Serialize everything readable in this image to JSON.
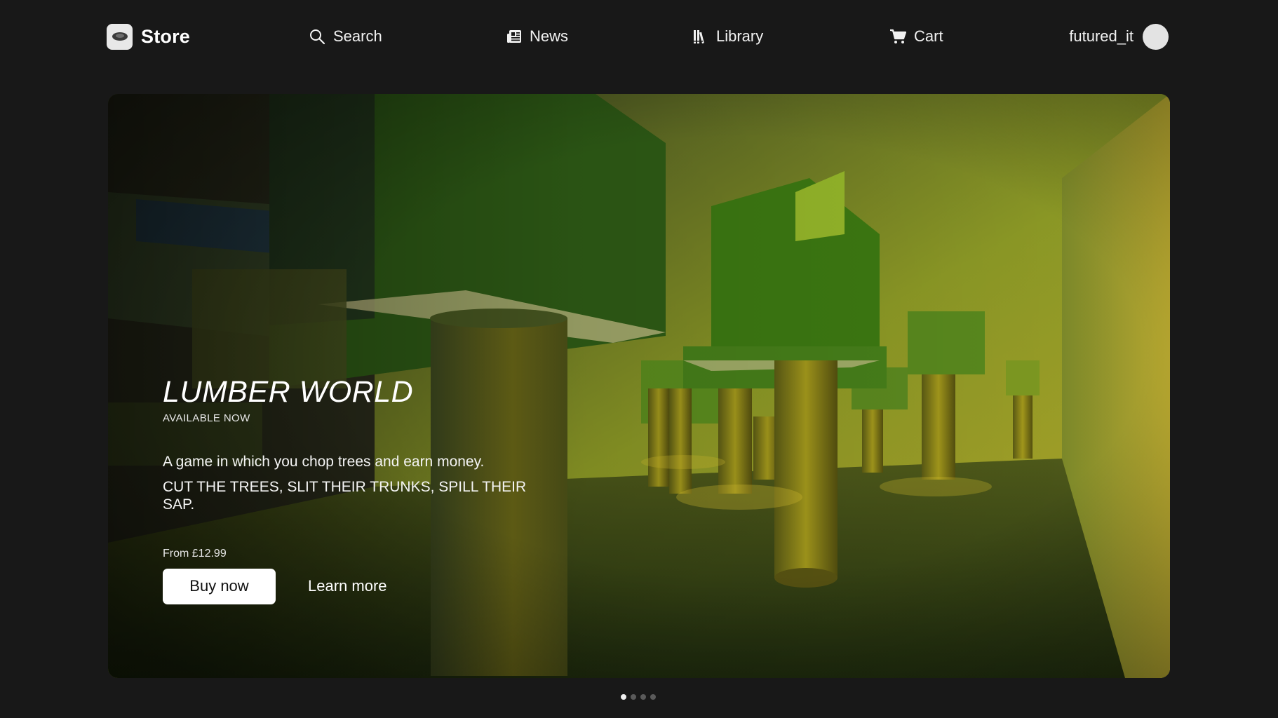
{
  "header": {
    "brand_label": "Store",
    "nav": [
      {
        "label": "Search",
        "icon": "search-icon"
      },
      {
        "label": "News",
        "icon": "newspaper-icon"
      },
      {
        "label": "Library",
        "icon": "library-icon"
      },
      {
        "label": "Cart",
        "icon": "cart-icon"
      }
    ],
    "username": "futured_it"
  },
  "hero": {
    "title": "LUMBER WORLD",
    "subtitle": "AVAILABLE NOW",
    "description": "A game in which you chop trees and earn money.",
    "tagline": "CUT THE TREES, SLIT THEIR TRUNKS, SPILL THEIR SAP.",
    "price": "From £12.99",
    "buy_label": "Buy now",
    "learn_label": "Learn more"
  },
  "carousel": {
    "slide_count": 4,
    "active_index": 0
  },
  "colors": {
    "background": "#181818",
    "button_bg": "#ffffff",
    "dot_active": "#f0f0f0",
    "dot_inactive": "#5a5a5a"
  }
}
